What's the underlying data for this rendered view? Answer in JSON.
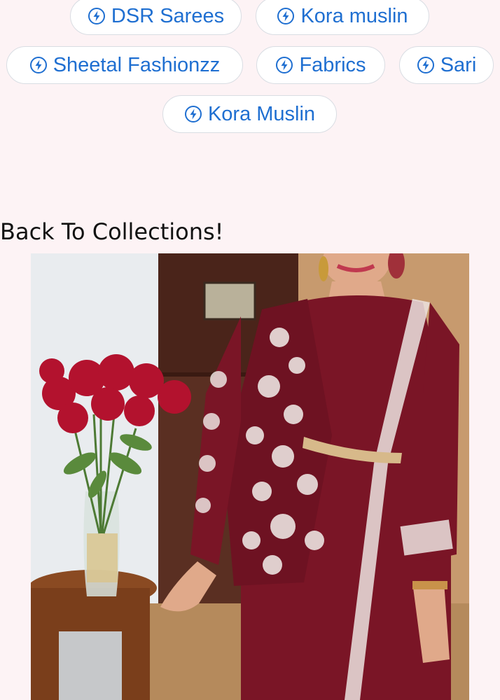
{
  "tags": [
    {
      "label": "DSR Sarees",
      "icon": "bolt-circle-icon"
    },
    {
      "label": "Kora muslin",
      "icon": "bolt-circle-icon"
    },
    {
      "label": "Sheetal Fashionzz",
      "icon": "bolt-circle-icon"
    },
    {
      "label": "Fabrics",
      "icon": "bolt-circle-icon"
    },
    {
      "label": "Sari",
      "icon": "bolt-circle-icon"
    },
    {
      "label": "Kora Muslin",
      "icon": "bolt-circle-icon"
    }
  ],
  "collections_link": "Back To Collections!",
  "colors": {
    "background": "#fdf3f5",
    "chip_text": "#1f6fd1",
    "chip_border": "#d9dde3",
    "outfit": "#7a1526"
  }
}
